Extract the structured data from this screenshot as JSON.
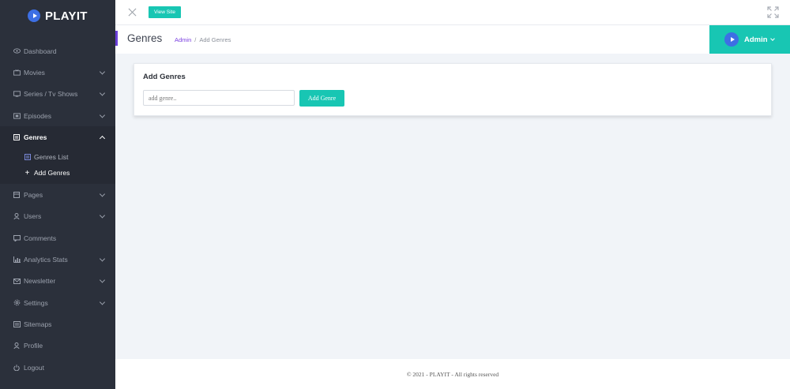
{
  "brand": {
    "name": "PLAYIT",
    "icon": "play-icon",
    "accent": "#3d6fe4"
  },
  "sidebar": {
    "items": [
      {
        "label": "Dashboard",
        "icon": "eye-icon",
        "has_chevron": false
      },
      {
        "label": "Movies",
        "icon": "film-icon",
        "has_chevron": true
      },
      {
        "label": "Series / Tv Shows",
        "icon": "tv-icon",
        "has_chevron": true
      },
      {
        "label": "Episodes",
        "icon": "episodes-icon",
        "has_chevron": true
      },
      {
        "label": "Genres",
        "icon": "genres-icon",
        "has_chevron": true,
        "active": true,
        "children": [
          {
            "label": "Genres List",
            "icon": "list-icon"
          },
          {
            "label": "Add Genres",
            "icon": "plus-icon",
            "current": true
          }
        ]
      },
      {
        "label": "Pages",
        "icon": "pages-icon",
        "has_chevron": true
      },
      {
        "label": "Users",
        "icon": "user-icon",
        "has_chevron": true
      },
      {
        "label": "Comments",
        "icon": "comment-icon",
        "has_chevron": false
      },
      {
        "label": "Analytics Stats",
        "icon": "chart-icon",
        "has_chevron": true
      },
      {
        "label": "Newsletter",
        "icon": "mail-icon",
        "has_chevron": true
      },
      {
        "label": "Settings",
        "icon": "gear-icon",
        "has_chevron": true
      },
      {
        "label": "Sitemaps",
        "icon": "sitemap-icon",
        "has_chevron": false
      },
      {
        "label": "Profile",
        "icon": "profile-icon",
        "has_chevron": false
      },
      {
        "label": "Logout",
        "icon": "power-icon",
        "has_chevron": false
      }
    ]
  },
  "topbar": {
    "view_site_label": "View Site",
    "close_icon": "close-icon",
    "fullscreen_icon": "fullscreen-icon"
  },
  "header": {
    "title": "Genres",
    "breadcrumb": {
      "link": "Admin",
      "separator": "/",
      "current": "Add Genres"
    },
    "user": {
      "name": "Admin",
      "avatar_icon": "play-icon"
    }
  },
  "card": {
    "title": "Add Genres",
    "input_placeholder": "add genre..",
    "input_value": "",
    "button_label": "Add Genre"
  },
  "footer": {
    "text": "© 2021 - PLAYIT - All rights reserved"
  },
  "colors": {
    "sidebar_bg": "#2b303b",
    "accent_teal": "#18c6b3",
    "accent_purple": "#6a3fd8",
    "page_bg": "#f1f4f8"
  }
}
